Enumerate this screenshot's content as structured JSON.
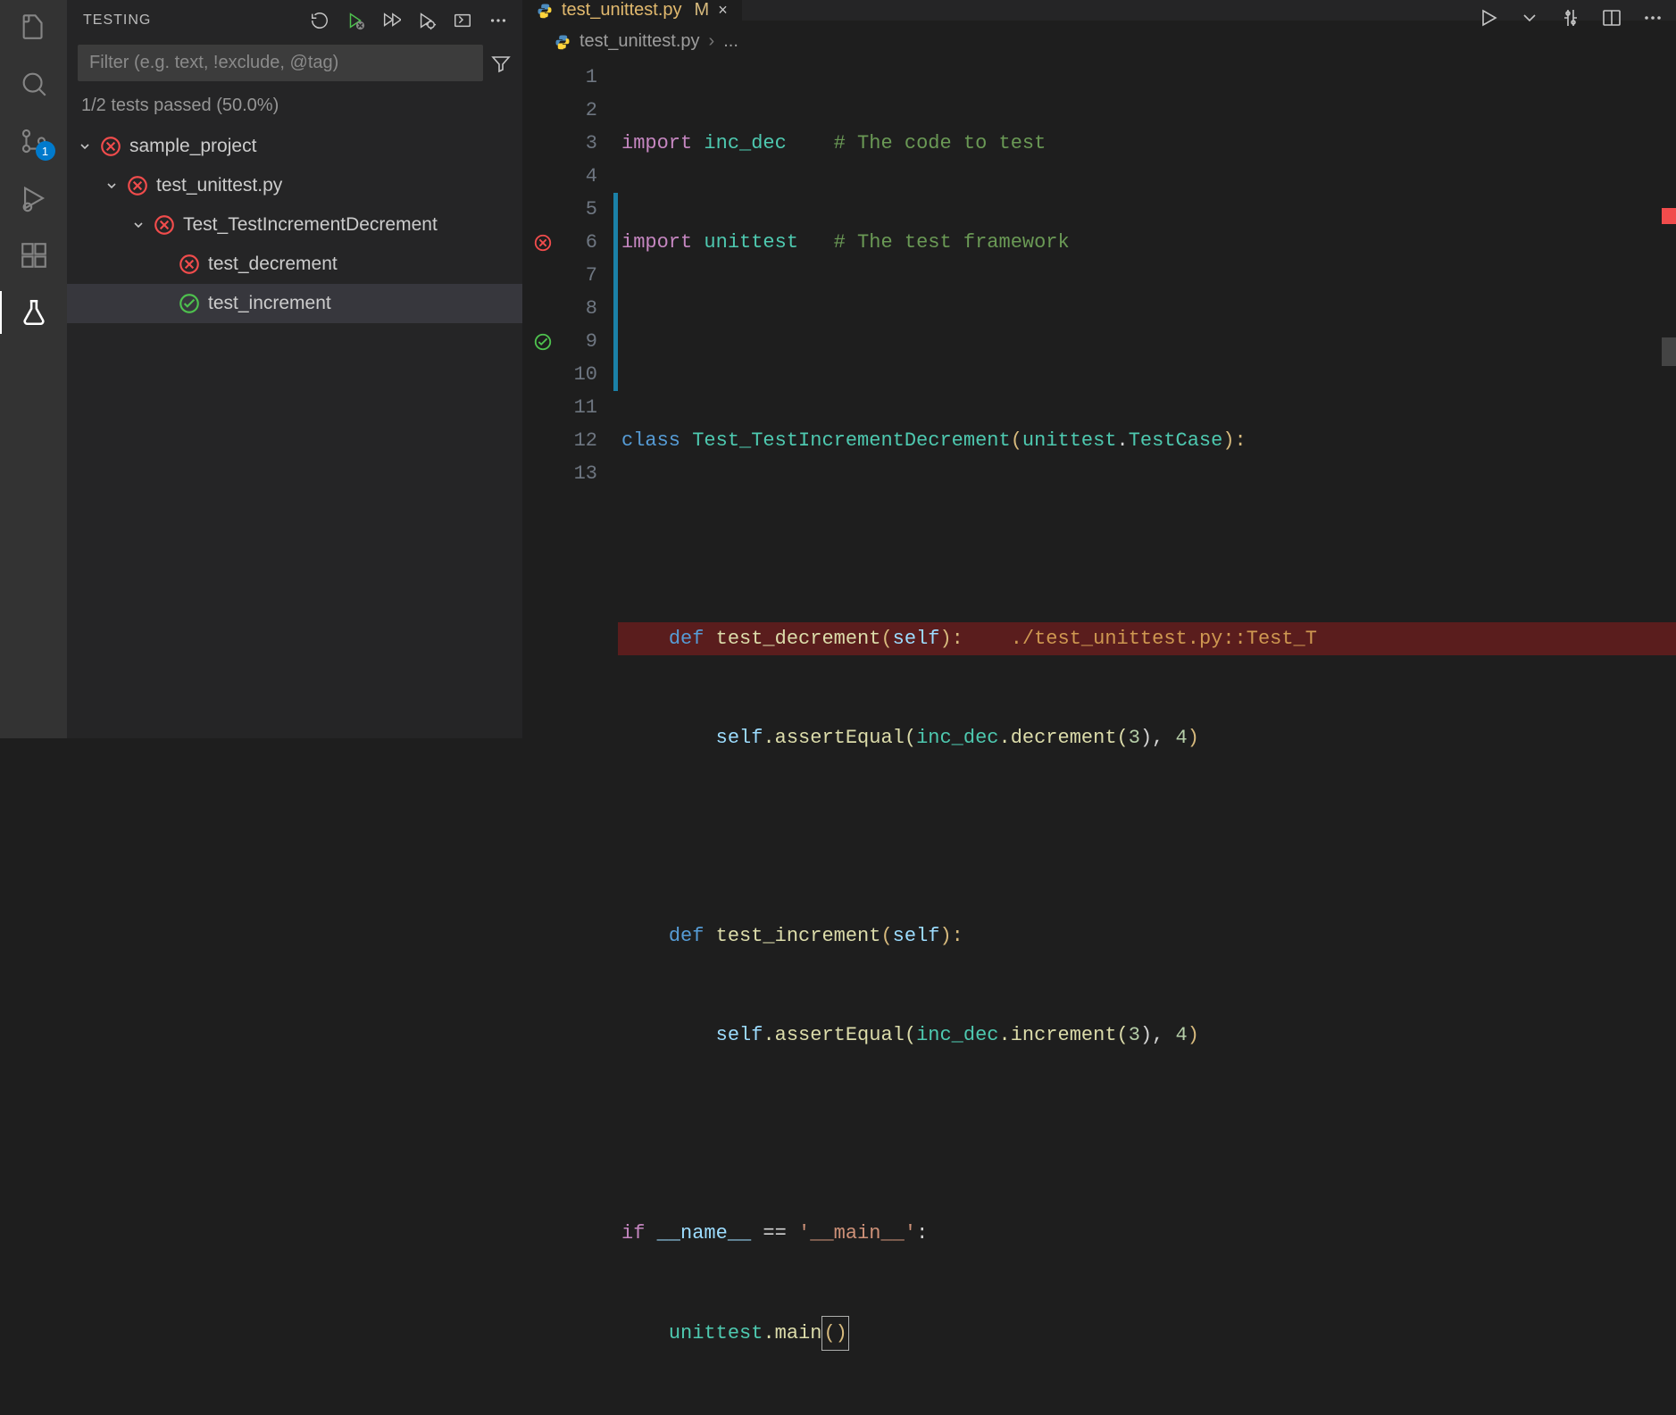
{
  "activity": {
    "source_control_badge": "1"
  },
  "sidebar": {
    "title": "TESTING",
    "filter_placeholder": "Filter (e.g. text, !exclude, @tag)",
    "summary": "1/2 tests passed (50.0%)",
    "tree": {
      "root": "sample_project",
      "file": "test_unittest.py",
      "class": "Test_TestIncrementDecrement",
      "test_fail": "test_decrement",
      "test_pass": "test_increment"
    }
  },
  "tab": {
    "filename": "test_unittest.py",
    "modified_marker": "M",
    "close": "×"
  },
  "breadcrumbs": {
    "file": "test_unittest.py",
    "sep": "›",
    "tail": "..."
  },
  "code": {
    "l1a": "import",
    "l1b": "inc_dec",
    "l1c": "# The code to test",
    "l2a": "import",
    "l2b": "unittest",
    "l2c": "# The test framework",
    "l4a": "class",
    "l4b": "Test_TestIncrementDecrement",
    "l4c": "(",
    "l4d": "unittest",
    "l4e": ".",
    "l4f": "TestCase",
    "l4g": "):",
    "l6a": "def",
    "l6b": "test_decrement",
    "l6c": "(",
    "l6d": "self",
    "l6e": "):",
    "l6f": "./test_unittest.py::Test_T",
    "l7a": "self",
    "l7b": ".assertEqual(",
    "l7c": "inc_dec",
    "l7d": ".decrement(",
    "l7e": "3",
    "l7f": "), ",
    "l7g": "4",
    "l7h": ")",
    "l9a": "def",
    "l9b": "test_increment",
    "l9c": "(",
    "l9d": "self",
    "l9e": "):",
    "l10a": "self",
    "l10b": ".assertEqual(",
    "l10c": "inc_dec",
    "l10d": ".increment(",
    "l10e": "3",
    "l10f": "), ",
    "l10g": "4",
    "l10h": ")",
    "l12a": "if",
    "l12b": "__name__",
    "l12c": " == ",
    "l12d": "'__main__'",
    "l12e": ":",
    "l13a": "unittest",
    "l13b": ".main",
    "l13c": "()"
  },
  "linenos": [
    "1",
    "2",
    "3",
    "4",
    "5",
    "6",
    "7",
    "8",
    "9",
    "10",
    "11",
    "12",
    "13"
  ]
}
